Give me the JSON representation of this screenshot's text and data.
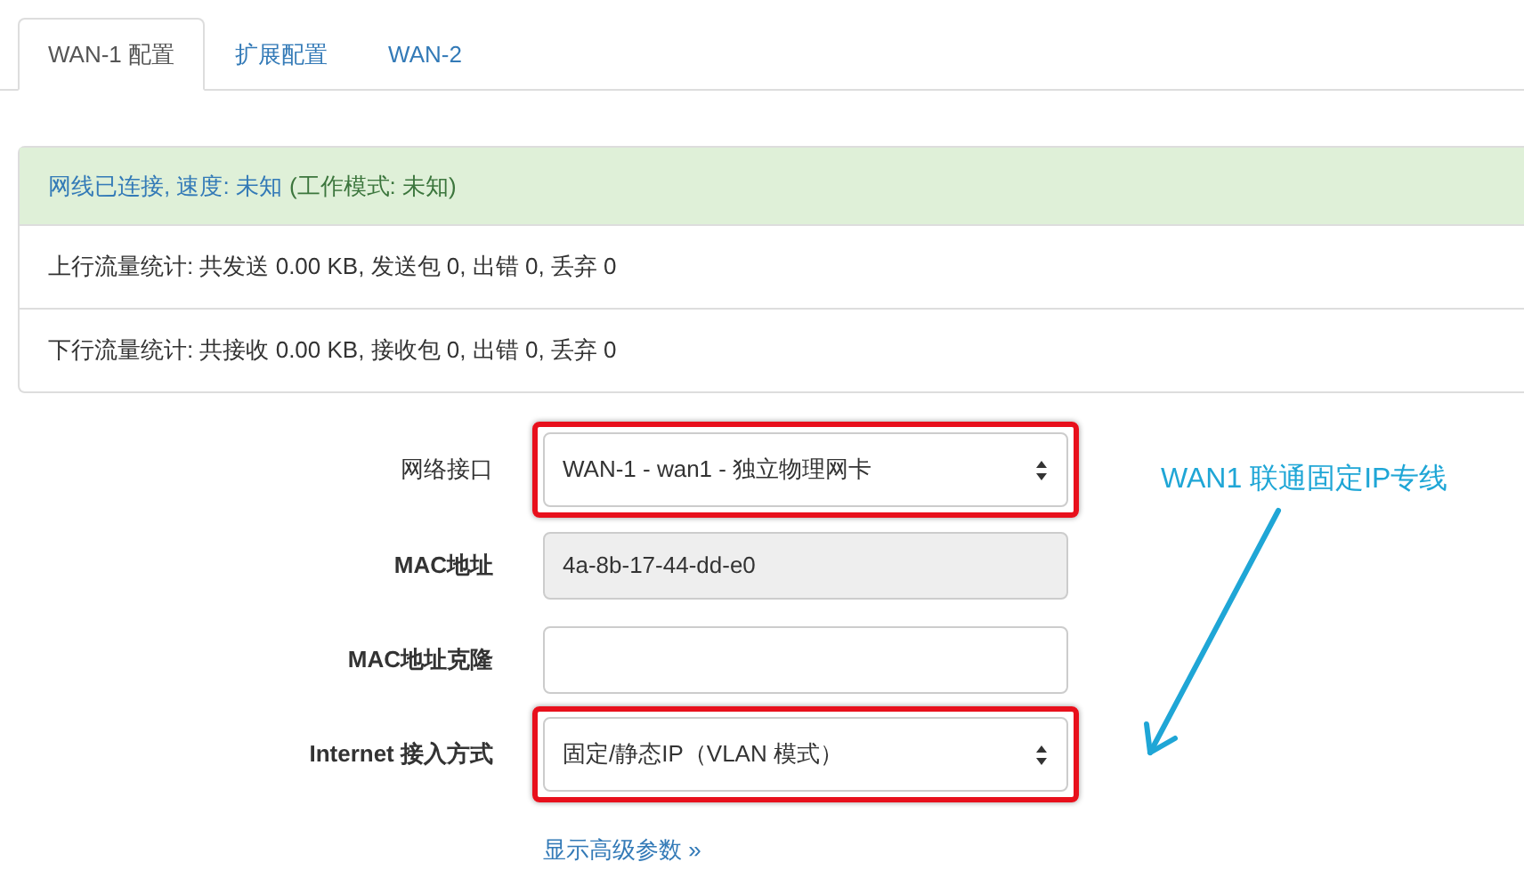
{
  "tabs": [
    {
      "label": "WAN-1 配置",
      "selected": true
    },
    {
      "label": "扩展配置",
      "selected": false
    },
    {
      "label": "WAN-2",
      "selected": false
    }
  ],
  "status_panel": {
    "connection": {
      "link_text": "网线已连接, 速度: 未知",
      "mode_text": "(工作模式: 未知)"
    },
    "upload_stats": "上行流量统计: 共发送 0.00 KB, 发送包 0, 出错 0, 丢弃 0",
    "download_stats": "下行流量统计: 共接收 0.00 KB, 接收包 0, 出错 0, 丢弃 0"
  },
  "form": {
    "fields": [
      {
        "label": "网络接口",
        "kind": "select",
        "value": "WAN-1 - wan1 - 独立物理网卡",
        "highlighted": true
      },
      {
        "label": "MAC地址",
        "kind": "readonly",
        "value": "4a-8b-17-44-dd-e0",
        "highlighted": false
      },
      {
        "label": "MAC地址克隆",
        "kind": "text",
        "highlighted": false
      },
      {
        "label": "Internet 接入方式",
        "kind": "select",
        "value": "固定/静态IP（VLAN 模式）",
        "highlighted": true
      }
    ],
    "advanced_link": "显示高级参数 »"
  },
  "annotation": {
    "text": "WAN1 联通固定IP专线"
  }
}
